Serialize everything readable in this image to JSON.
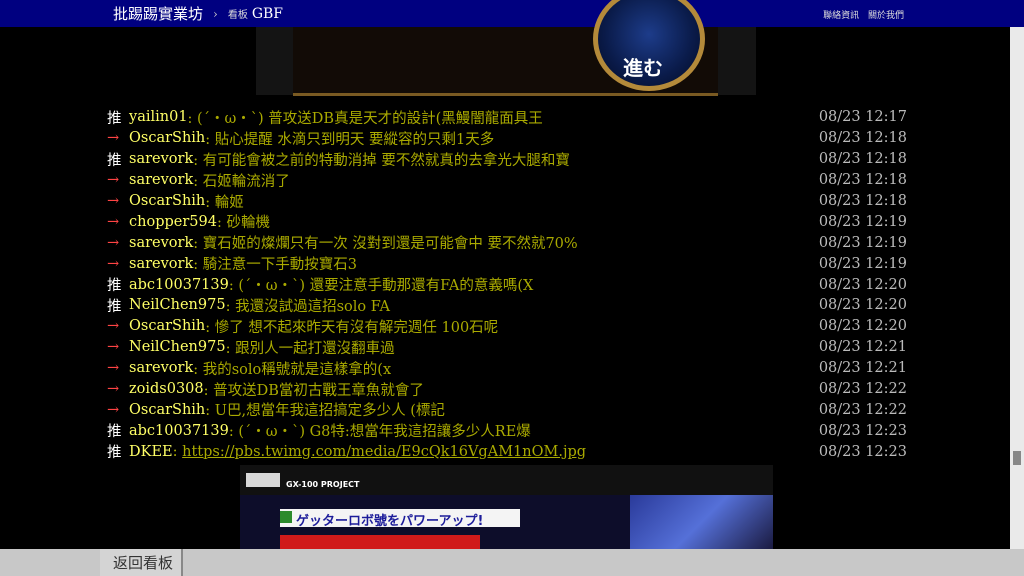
{
  "header": {
    "site_title": "批踢踢實業坊",
    "separator": "›",
    "board_label": "看板",
    "board_name": "GBF",
    "links": [
      "聯絡資訊",
      "關於我們"
    ]
  },
  "top_image": {
    "button_text": "進む"
  },
  "comments": [
    {
      "tag": "推",
      "user": "yailin01",
      "text": ": (´・ω・`) 普攻送DB真是天才的設計(黑鰻闇龍面具王",
      "time": "08/23 12:17"
    },
    {
      "tag": "→",
      "user": "OscarShih",
      "text": ": 貼心提醒 水滴只到明天 要縱容的只剩1天多",
      "time": "08/23 12:18"
    },
    {
      "tag": "推",
      "user": "sarevork",
      "text": ": 有可能會被之前的特動消掉 要不然就真的去拿光大腿和寶",
      "time": "08/23 12:18"
    },
    {
      "tag": "→",
      "user": "sarevork",
      "text": ": 石姬輪流消了",
      "time": "08/23 12:18"
    },
    {
      "tag": "→",
      "user": "OscarShih",
      "text": ": 輪姬",
      "time": "08/23 12:18"
    },
    {
      "tag": "→",
      "user": "chopper594",
      "text": ": 砂輪機",
      "time": "08/23 12:19"
    },
    {
      "tag": "→",
      "user": "sarevork",
      "text": ": 寶石姬的燦爛只有一次 沒對到還是可能會中 要不然就70%",
      "time": "08/23 12:19"
    },
    {
      "tag": "→",
      "user": "sarevork",
      "text": ": 騎注意一下手動按寶石3",
      "time": "08/23 12:19"
    },
    {
      "tag": "推",
      "user": "abc10037139",
      "text": ": (´・ω・`) 還要注意手動那還有FA的意義嗎(X",
      "time": "08/23 12:20"
    },
    {
      "tag": "推",
      "user": "NeilChen975",
      "text": ": 我還沒試過這招solo FA",
      "time": "08/23 12:20"
    },
    {
      "tag": "→",
      "user": "OscarShih",
      "text": ": 慘了 想不起來昨天有沒有解完週任 100石呢",
      "time": "08/23 12:20"
    },
    {
      "tag": "→",
      "user": "NeilChen975",
      "text": ": 跟別人一起打還沒翻車過",
      "time": "08/23 12:21"
    },
    {
      "tag": "→",
      "user": "sarevork",
      "text": ": 我的solo稱號就是這樣拿的(x",
      "time": "08/23 12:21"
    },
    {
      "tag": "→",
      "user": "zoids0308",
      "text": ": 普攻送DB當初古戰王章魚就會了",
      "time": "08/23 12:22"
    },
    {
      "tag": "→",
      "user": "OscarShih",
      "text": ": U巴,想當年我這招搞定多少人 (標記",
      "time": "08/23 12:22"
    },
    {
      "tag": "推",
      "user": "abc10037139",
      "text": ": (´・ω・`) G8特:想當年我這招讓多少人RE爆",
      "time": "08/23 12:23"
    },
    {
      "tag": "推",
      "user": "DKEE",
      "text": ": ",
      "link": "https://pbs.twimg.com/media/E9cQk16VgAM1nOM.jpg",
      "time": "08/23 12:23"
    }
  ],
  "bottom_image": {
    "project": "GX-100 PROJECT",
    "banner": "ゲッターロボ號をパワーアップ!"
  },
  "footer": {
    "back_label": "返回看板"
  }
}
